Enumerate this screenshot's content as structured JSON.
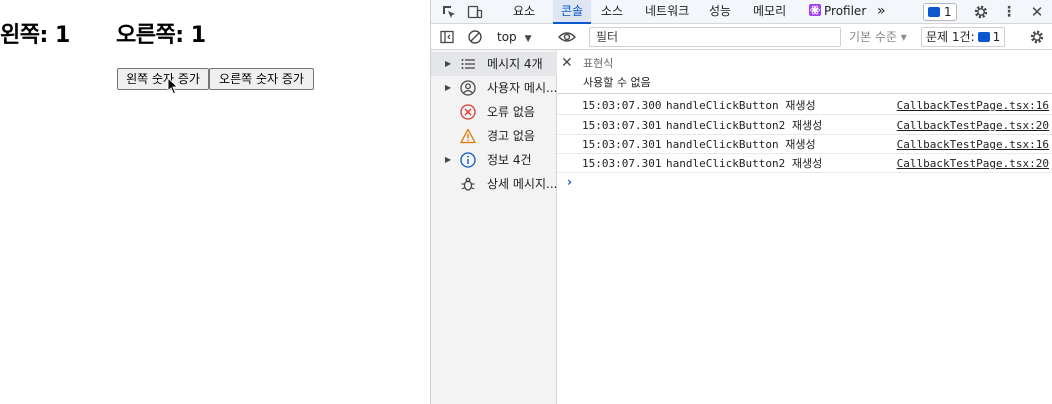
{
  "app": {
    "left_label": "왼쪽:",
    "left_value": "1",
    "right_label": "오른쪽:",
    "right_value": "1",
    "btn_left": "왼쪽 숫자 증가",
    "btn_right": "오른쪽 숫자 증가"
  },
  "devtools": {
    "tabs": [
      "요소",
      "콘솔",
      "소스",
      "네트워크",
      "성능",
      "메모리",
      "Profiler"
    ],
    "active_tab": "콘솔",
    "more": "»",
    "issue_badge_count": "1",
    "toolbar": {
      "context": "top",
      "filter_placeholder": "필터",
      "level": "기본 수준 ▾",
      "issues_label": "문제 1건:",
      "issues_count": "1"
    },
    "sidebar": [
      {
        "label": "메시지 4개",
        "icon": "list-icon",
        "expandable": true
      },
      {
        "label": "사용자 메시...",
        "icon": "user-icon",
        "expandable": true
      },
      {
        "label": "오류 없음",
        "icon": "error-icon",
        "expandable": false
      },
      {
        "label": "경고 없음",
        "icon": "warning-icon",
        "expandable": false
      },
      {
        "label": "정보 4건",
        "icon": "info-icon",
        "expandable": true
      },
      {
        "label": "상세 메시지...",
        "icon": "bug-icon",
        "expandable": false
      }
    ],
    "live_expression": {
      "name": "표현식",
      "value": "사용할 수 없음"
    },
    "logs": [
      {
        "ts": "15:03:07.300",
        "msg": "handleClickButton 재생성",
        "src": "CallbackTestPage.tsx:16"
      },
      {
        "ts": "15:03:07.301",
        "msg": "handleClickButton2 재생성",
        "src": "CallbackTestPage.tsx:20"
      },
      {
        "ts": "15:03:07.301",
        "msg": "handleClickButton 재생성",
        "src": "CallbackTestPage.tsx:16"
      },
      {
        "ts": "15:03:07.301",
        "msg": "handleClickButton2 재생성",
        "src": "CallbackTestPage.tsx:20"
      }
    ],
    "prompt": "›"
  }
}
